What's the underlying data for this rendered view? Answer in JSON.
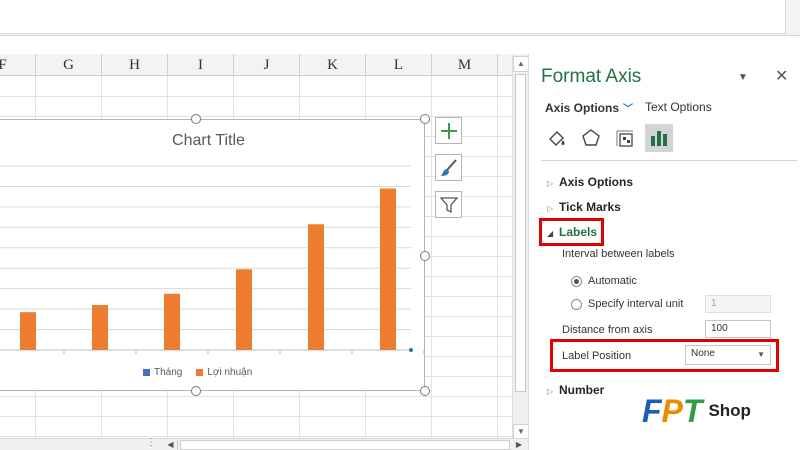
{
  "sheet": {
    "columns": [
      "F",
      "G",
      "H",
      "I",
      "J",
      "K",
      "L",
      "M"
    ]
  },
  "chart": {
    "title": "Chart Title",
    "legend": [
      {
        "name": "Tháng",
        "color": "#4472c4"
      },
      {
        "name": "Lợi nhuận",
        "color": "#ed7d31"
      }
    ]
  },
  "chart_data": {
    "type": "bar",
    "title": "Chart Title",
    "series": [
      {
        "name": "Tháng",
        "values": [],
        "color": "#4472c4"
      },
      {
        "name": "Lợi nhuận",
        "values": [
          37,
          44,
          55,
          79,
          123,
          158
        ],
        "color": "#ed7d31"
      }
    ],
    "ylim": [
      0,
      180
    ],
    "grid": true,
    "legend_position": "bottom"
  },
  "pane": {
    "title": "Format Axis",
    "tabs": [
      {
        "label": "Axis Options",
        "active": true
      },
      {
        "label": "Text Options",
        "active": false
      }
    ],
    "icons": [
      "fill-line-icon",
      "effects-icon",
      "size-properties-icon",
      "axis-options-icon"
    ],
    "sections": {
      "axis_options": "Axis Options",
      "tick_marks": "Tick Marks",
      "labels": "Labels",
      "number": "Number"
    },
    "interval_label": "Interval between labels",
    "radio_automatic": "Automatic",
    "radio_specify": "Specify interval unit",
    "specify_value": "1",
    "distance_label": "Distance from axis",
    "distance_value": "100",
    "label_position_label": "Label Position",
    "label_position_value": "None"
  },
  "logo": {
    "letters": [
      "F",
      "P",
      "T"
    ],
    "shop": "Shop",
    "colors": {
      "F": "#1a5fb4",
      "P": "#f08a00",
      "T": "#2f9e44"
    }
  }
}
